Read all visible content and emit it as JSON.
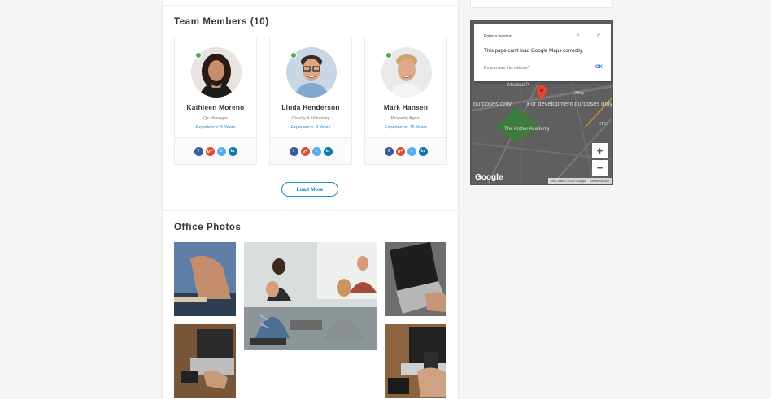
{
  "team": {
    "title": "Team Members (10)",
    "members": [
      {
        "name": "Kathleen Moreno",
        "role": "Qs Manager",
        "experience": "Experience: 5 Years"
      },
      {
        "name": "Linda Henderson",
        "role": "Charity & Voluntary",
        "experience": "Experience: 9 Years"
      },
      {
        "name": "Mark Hansen",
        "role": "Property Agent",
        "experience": "Experience: 15 Years"
      }
    ],
    "social": {
      "facebook": "f",
      "googleplus": "g+",
      "twitter": "t",
      "linkedin": "in"
    },
    "load_more": "Load More"
  },
  "photos": {
    "title": "Office Photos"
  },
  "map": {
    "search_placeholder": "Enter a location",
    "error": "This page can't load Google Maps correctly.",
    "own_site": "Do you own this website?",
    "ok": "OK",
    "label_medical": "Medical P",
    "label_dev_left": "purposes only",
    "label_dev_right": "For development purposes only",
    "label_academy": "The Archer Academy",
    "label_kfc": "KFC",
    "label_atley": "Atley",
    "zoom_in": "+",
    "zoom_out": "−",
    "google": "Google",
    "map_data": "Map data ©2019 Google",
    "terms": "Terms of Use"
  },
  "colors": {
    "accent": "#1e88c8",
    "online": "#4caf50",
    "map_bg": "#5e5e5e"
  }
}
